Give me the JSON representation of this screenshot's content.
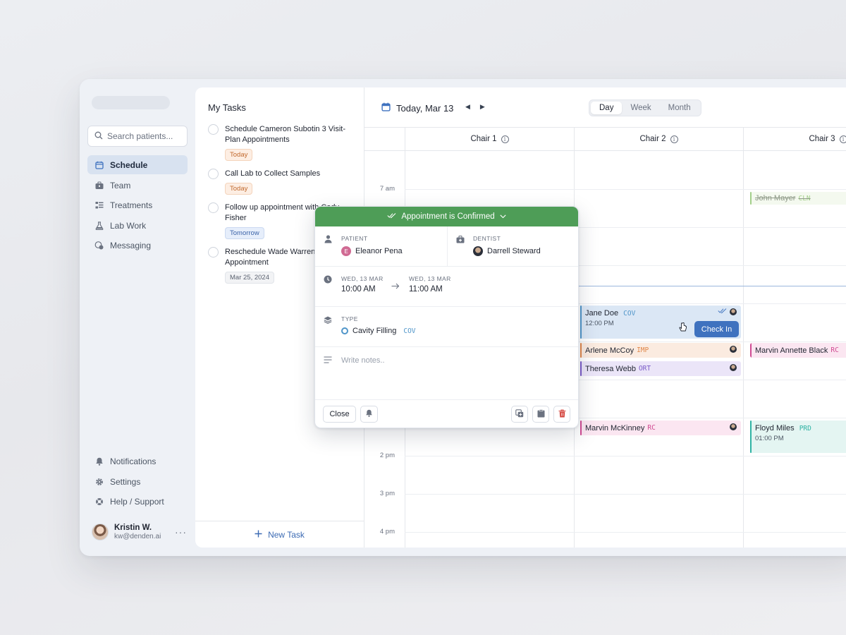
{
  "sidebar": {
    "search_placeholder": "Search patients...",
    "nav": [
      {
        "label": "Schedule",
        "icon": "calendar-icon",
        "active": true
      },
      {
        "label": "Team",
        "icon": "briefcase-icon"
      },
      {
        "label": "Treatments",
        "icon": "list-icon"
      },
      {
        "label": "Lab Work",
        "icon": "flask-icon"
      },
      {
        "label": "Messaging",
        "icon": "chat-icon"
      }
    ],
    "bottom_nav": [
      {
        "label": "Notifications",
        "icon": "bell-icon"
      },
      {
        "label": "Settings",
        "icon": "gear-icon"
      },
      {
        "label": "Help / Support",
        "icon": "lifebuoy-icon"
      }
    ],
    "user": {
      "name": "Kristin W.",
      "email": "kw@denden.ai",
      "more": "···"
    }
  },
  "tasks": {
    "title": "My Tasks",
    "items": [
      {
        "text": "Schedule Cameron Subotin 3 Visit-Plan Appointments",
        "tag": "Today"
      },
      {
        "text": "Call Lab to Collect Samples",
        "tag": "Today"
      },
      {
        "text": "Follow up appointment with Cody Fisher",
        "tag": "Tomorrow"
      },
      {
        "text": "Reschedule Wade Warren Appointment",
        "tag": "Mar 25, 2024"
      }
    ],
    "new_task": "New Task"
  },
  "calendar": {
    "date_label": "Today, Mar 13",
    "views": [
      "Day",
      "Week",
      "Month"
    ],
    "active_view": "Day",
    "chairs": [
      "Chair 1",
      "Chair 2",
      "Chair 3"
    ],
    "time_labels": [
      "7 am",
      "2 pm",
      "3 pm",
      "4 pm"
    ],
    "appointments": [
      {
        "name": "John Mayer",
        "code": "CLN",
        "chair": 3,
        "status": "cancelled"
      },
      {
        "name": "Jane Doe",
        "code": "COV",
        "time": "12:00 PM",
        "chair": 2,
        "action": "Check In"
      },
      {
        "name": "Arlene McCoy",
        "code": "IMP",
        "chair": 2
      },
      {
        "name": "Theresa Webb",
        "code": "ORT",
        "chair": 2
      },
      {
        "name": "Marvin Annette Black",
        "code": "RC",
        "chair": 3
      },
      {
        "name": "Marvin McKinney",
        "code": "RC",
        "chair": 2
      },
      {
        "name": "Floyd Miles",
        "code": "PRD",
        "time": "01:00 PM",
        "chair": 3
      }
    ]
  },
  "popover": {
    "status": "Appointment is Confirmed",
    "patient_label": "PATIENT",
    "patient_initial": "E",
    "patient_name": "Eleanor Pena",
    "dentist_label": "DENTIST",
    "dentist_name": "Darrell Steward",
    "start_date": "WED, 13 MAR",
    "start_time": "10:00 AM",
    "end_date": "WED, 13 MAR",
    "end_time": "11:00 AM",
    "type_label": "TYPE",
    "type_value": "Cavity Filling",
    "type_code": "COV",
    "notes_placeholder": "Write notes..",
    "close": "Close"
  },
  "colors": {
    "accent": "#3f72bf",
    "confirmed": "#4e9d57",
    "cov": "#4f95c9",
    "imp": "#e0874a",
    "ort": "#7a5cc8",
    "rc": "#d04a92",
    "prd": "#2fb3a4",
    "cln": "#a3cf8a"
  }
}
